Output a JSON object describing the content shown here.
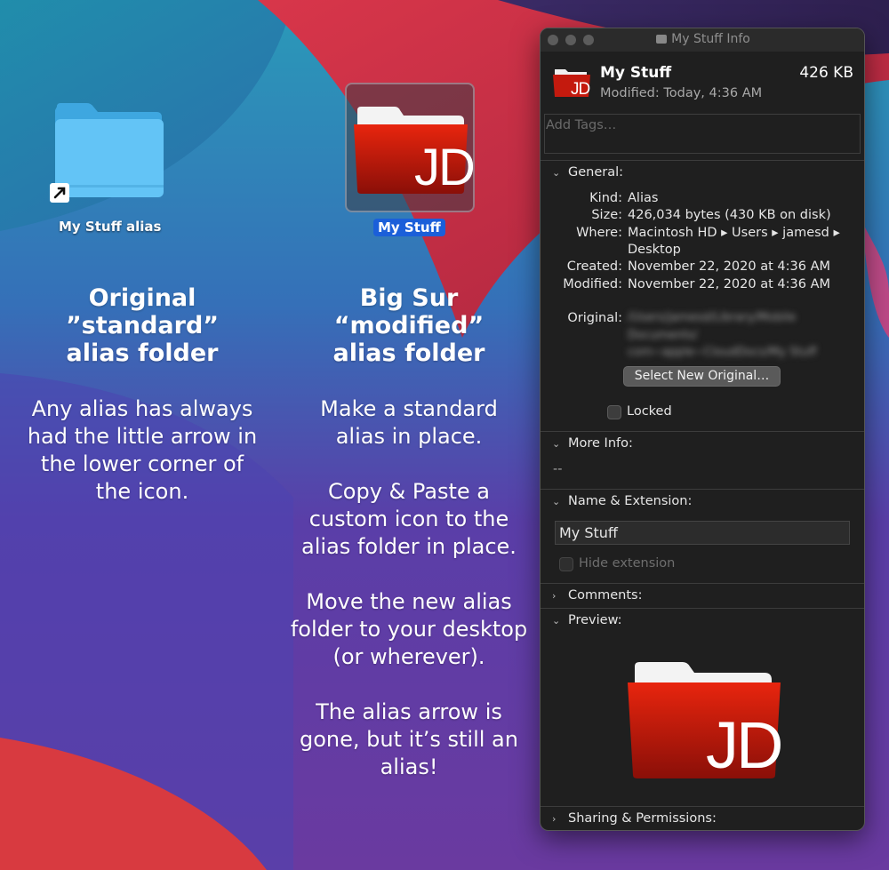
{
  "desktop": {
    "alias_icon_label": "My Stuff alias",
    "custom_icon_label": "My Stuff",
    "custom_icon_monogram": "JD"
  },
  "captions": {
    "left": {
      "title_lines": [
        "Original",
        "”standard”",
        "alias folder"
      ],
      "body_lines": [
        "Any alias has always",
        "had the little arrow in",
        "the lower corner of",
        "the icon."
      ]
    },
    "right": {
      "title_lines": [
        "Big Sur",
        "“modified”",
        "alias folder"
      ],
      "body_lines": [
        "Make a standard",
        "alias in place.",
        "Copy & Paste a",
        "custom icon to the",
        "alias folder in place.",
        "Move the new alias",
        "folder to your desktop",
        "(or wherever).",
        "The alias arrow is",
        "gone, but it’s still an",
        "alias!"
      ]
    }
  },
  "info_window": {
    "title": "My Stuff Info",
    "header": {
      "name": "My Stuff",
      "size": "426 KB",
      "modified": "Modified: Today, 4:36 AM"
    },
    "tags_placeholder": "Add Tags…",
    "general": {
      "heading": "General:",
      "kind_label": "Kind:",
      "kind": "Alias",
      "size_label": "Size:",
      "size": "426,034 bytes (430 KB on disk)",
      "where_label": "Where:",
      "where_line1": "Macintosh HD ▸ Users ▸ jamesd ▸",
      "where_line2": "Desktop",
      "created_label": "Created:",
      "created": "November 22, 2020 at 4:36 AM",
      "modified_label": "Modified:",
      "modified": "November 22, 2020 at 4:36 AM",
      "original_label": "Original:",
      "select_original_button": "Select New Original…",
      "locked_label": "Locked"
    },
    "more_info": {
      "heading": "More Info:",
      "value": "--"
    },
    "name_ext": {
      "heading": "Name & Extension:",
      "name_value": "My Stuff",
      "hide_extension_label": "Hide extension"
    },
    "comments": {
      "heading": "Comments:"
    },
    "preview": {
      "heading": "Preview:"
    },
    "sharing": {
      "heading": "Sharing & Permissions:"
    }
  },
  "colors": {
    "folder_blue": "#5bc0f5",
    "folder_red": "#c41a0e",
    "selection_blue": "#1b5fd9",
    "window_bg": "#1f1f1f"
  },
  "icons": {
    "chevron_open": "⌄",
    "chevron_closed": "›"
  }
}
